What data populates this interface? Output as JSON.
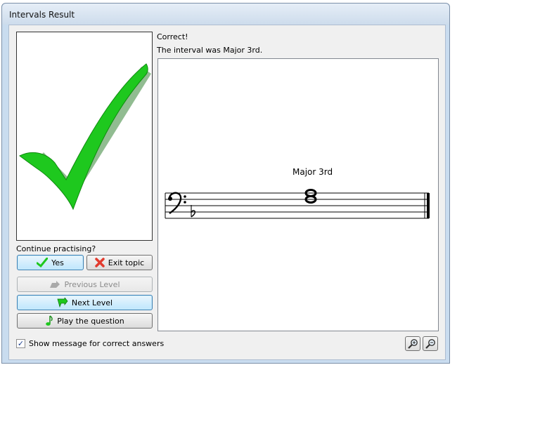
{
  "window": {
    "title": "Intervals Result"
  },
  "result": {
    "status": "Correct!",
    "message": "The interval was Major 3rd.",
    "interval_label": "Major 3rd"
  },
  "prompt": "Continue practising?",
  "buttons": {
    "yes": "Yes",
    "exit_topic": "Exit topic",
    "previous_level": "Previous Level",
    "next_level": "Next Level",
    "play_question": "Play the question"
  },
  "options": {
    "show_message_label": "Show message for correct answers",
    "show_message_checked": true
  },
  "icons": {
    "result": "checkmark-icon",
    "yes": "check-icon",
    "exit": "red-x-icon",
    "previous": "up-arrow-icon",
    "next": "green-arrow-icon",
    "play": "music-note-icon",
    "zoom_in": "zoom-in-icon",
    "zoom_out": "zoom-out-icon"
  },
  "colors": {
    "check_green": "#1ec81e",
    "x_red": "#e23b2e",
    "focus_blue": "#3c7fb1"
  }
}
